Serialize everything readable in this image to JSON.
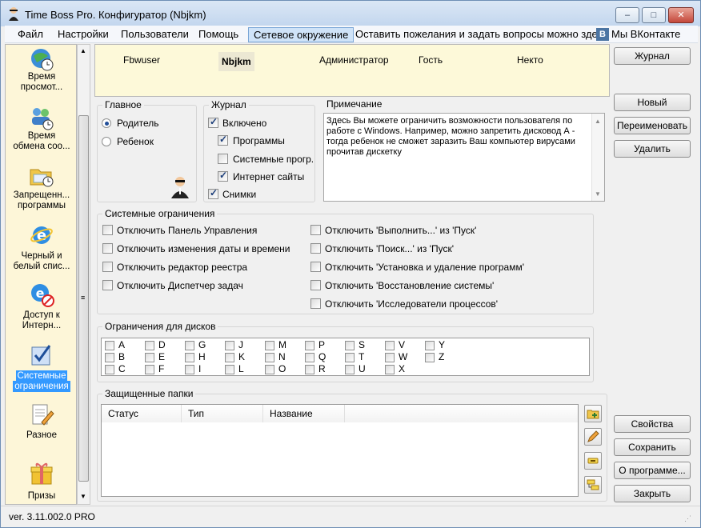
{
  "window": {
    "title": "Time Boss Pro. Конфигуратор (Nbjkm)",
    "min": "–",
    "max": "□",
    "close": "✕"
  },
  "menu": [
    "Файл",
    "Настройки",
    "Пользователи",
    "Помощь",
    "Сетевое окружение",
    "Оставить пожелания и задать вопросы можно здесь",
    "Мы ВКонтакте"
  ],
  "vk_badge": "B",
  "sidebar": [
    {
      "l1": "Время",
      "l2": "просмот..."
    },
    {
      "l1": "Время",
      "l2": "обмена соо..."
    },
    {
      "l1": "Запрещенн...",
      "l2": "программы"
    },
    {
      "l1": "Черный и",
      "l2": "белый спис..."
    },
    {
      "l1": "Доступ к",
      "l2": "Интерн..."
    },
    {
      "l1": "Системные",
      "l2": "ограничения"
    },
    {
      "l1": "Разное",
      "l2": ""
    },
    {
      "l1": "Призы",
      "l2": ""
    }
  ],
  "users": [
    "Fbwuser",
    "Nbjkm",
    "Администратор",
    "Гость",
    "Некто"
  ],
  "buttons": {
    "log": "Журнал",
    "new": "Новый",
    "rename": "Переименовать",
    "delete": "Удалить",
    "props": "Свойства",
    "save": "Сохранить",
    "about": "О программе...",
    "close": "Закрыть"
  },
  "main": {
    "title": "Главное",
    "parent": "Родитель",
    "child": "Ребенок"
  },
  "journal": {
    "title": "Журнал",
    "enabled": "Включено",
    "programs": "Программы",
    "sysprogs": "Системные прогр.",
    "sites": "Интернет сайты",
    "shots": "Снимки"
  },
  "note": {
    "title": "Примечание",
    "text": "Здесь Вы можете ограничить возможности пользователя по работе с Windows. Например, можно запретить дисковод А - тогда ребенок не сможет заразить Ваш компьютер вирусами прочитав дискетку"
  },
  "sys": {
    "title": "Системные ограничения",
    "left": [
      "Отключить Панель Управления",
      "Отключить изменения даты и времени",
      "Отключить редактор реестра",
      "Отключить Диспетчер задач"
    ],
    "right": [
      "Отключить 'Выполнить...' из 'Пуск'",
      "Отключить 'Поиск...' из 'Пуск'",
      "Отключить 'Установка и удаление программ'",
      "Отключить 'Восстановление системы'",
      "Отключить 'Исследователи процессов'"
    ]
  },
  "disks": {
    "title": "Ограничения для дисков",
    "cols": [
      [
        "A",
        "B",
        "C"
      ],
      [
        "D",
        "E",
        "F"
      ],
      [
        "G",
        "H",
        "I"
      ],
      [
        "J",
        "K",
        "L"
      ],
      [
        "M",
        "N",
        "O"
      ],
      [
        "P",
        "Q",
        "R"
      ],
      [
        "S",
        "T",
        "U"
      ],
      [
        "V",
        "W",
        "X"
      ],
      [
        "Y",
        "Z"
      ]
    ]
  },
  "folders": {
    "title": "Защищенные папки",
    "cols": [
      "Статус",
      "Тип",
      "Название"
    ]
  },
  "status": {
    "version": "ver. 3.11.002.0 PRO"
  }
}
